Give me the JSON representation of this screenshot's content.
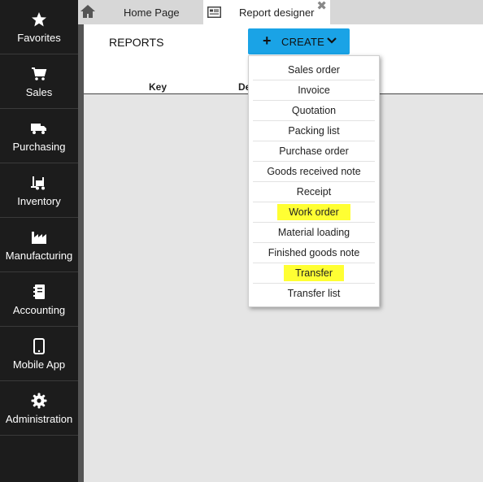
{
  "sidebar": {
    "items": [
      {
        "label": "Favorites",
        "icon": "star-icon"
      },
      {
        "label": "Sales",
        "icon": "cart-icon"
      },
      {
        "label": "Purchasing",
        "icon": "truck-icon"
      },
      {
        "label": "Inventory",
        "icon": "forklift-icon"
      },
      {
        "label": "Manufacturing",
        "icon": "factory-icon"
      },
      {
        "label": "Accounting",
        "icon": "ledger-icon"
      },
      {
        "label": "Mobile App",
        "icon": "phone-icon"
      },
      {
        "label": "Administration",
        "icon": "gear-icon"
      }
    ]
  },
  "tabs": {
    "home_label": "Home Page",
    "active_label": "Report designer",
    "close_symbol": "✖"
  },
  "main": {
    "title": "REPORTS",
    "create_label": "CREATE",
    "columns": {
      "key": "Key",
      "desc": "De"
    }
  },
  "dropdown": {
    "items": [
      {
        "label": "Sales order",
        "highlighted": false
      },
      {
        "label": "Invoice",
        "highlighted": false
      },
      {
        "label": "Quotation",
        "highlighted": false
      },
      {
        "label": "Packing list",
        "highlighted": false
      },
      {
        "label": "Purchase order",
        "highlighted": false
      },
      {
        "label": "Goods received note",
        "highlighted": false
      },
      {
        "label": "Receipt",
        "highlighted": false
      },
      {
        "label": "Work order",
        "highlighted": true
      },
      {
        "label": "Material loading",
        "highlighted": false
      },
      {
        "label": "Finished goods note",
        "highlighted": false
      },
      {
        "label": "Transfer",
        "highlighted": true
      },
      {
        "label": "Transfer list",
        "highlighted": false
      }
    ]
  },
  "colors": {
    "sidebar_bg": "#1c1c1c",
    "accent": "#1aa3e6",
    "highlight": "#ffff33",
    "gray_area": "#e5e5e5"
  }
}
